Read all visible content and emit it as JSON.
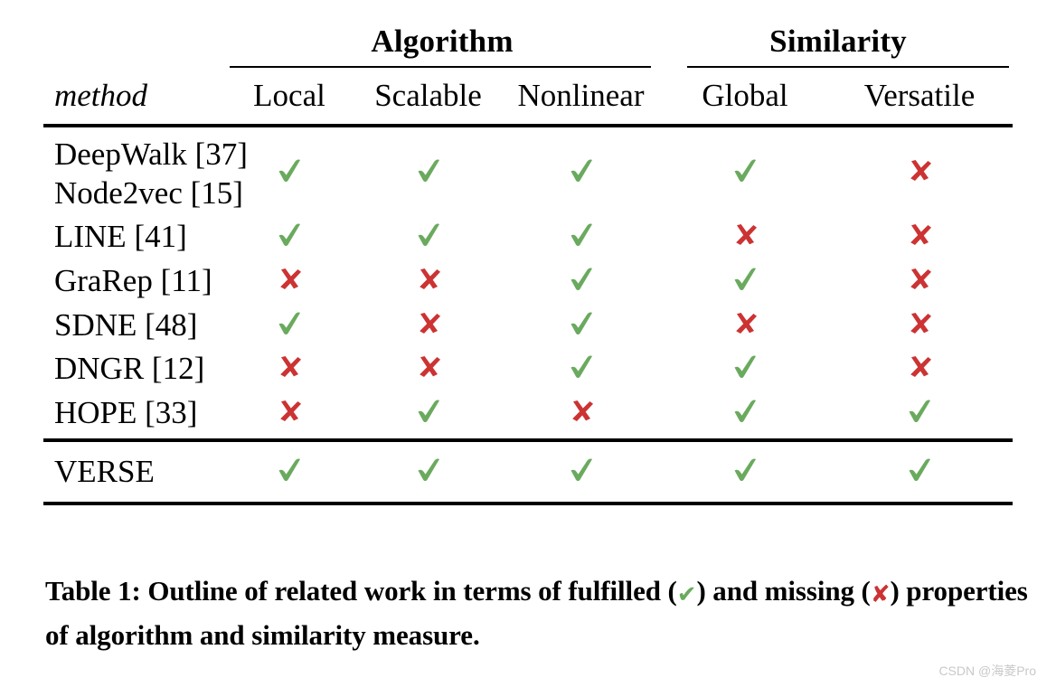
{
  "table": {
    "groups": [
      {
        "label": "Algorithm",
        "span": 3
      },
      {
        "label": "Similarity",
        "span": 2
      }
    ],
    "columns": {
      "method_header": "method",
      "marks": [
        "Local",
        "Scalable",
        "Nonlinear",
        "Global",
        "Versatile"
      ]
    },
    "rows": [
      {
        "methods": [
          "DeepWalk [37]",
          "Node2vec [15]"
        ],
        "marks": [
          "check",
          "check",
          "check",
          "check",
          "cross"
        ]
      },
      {
        "methods": [
          "LINE [41]"
        ],
        "marks": [
          "check",
          "check",
          "check",
          "cross",
          "cross"
        ]
      },
      {
        "methods": [
          "GraRep [11]"
        ],
        "marks": [
          "cross",
          "cross",
          "check",
          "check",
          "cross"
        ]
      },
      {
        "methods": [
          "SDNE [48]"
        ],
        "marks": [
          "check",
          "cross",
          "check",
          "cross",
          "cross"
        ]
      },
      {
        "methods": [
          "DNGR [12]"
        ],
        "marks": [
          "cross",
          "cross",
          "check",
          "check",
          "cross"
        ]
      },
      {
        "methods": [
          "HOPE [33]"
        ],
        "marks": [
          "cross",
          "check",
          "cross",
          "check",
          "check"
        ]
      }
    ],
    "highlight_row": {
      "methods": [
        "VERSE"
      ],
      "marks": [
        "check",
        "check",
        "check",
        "check",
        "check"
      ]
    }
  },
  "caption": {
    "line1_a": "Table 1: Outline of related work in terms of fulfilled (",
    "line1_b": ") and",
    "line2_a": "missing (",
    "line2_b": ") properties of algorithm and similarity measure."
  },
  "icons": {
    "check": "check-mark-icon",
    "cross": "cross-mark-icon"
  },
  "colors": {
    "check": "#6aaa5e",
    "cross": "#cc3333",
    "rule": "#000000",
    "watermark": "#c9c9c9"
  },
  "watermark": {
    "text": "CSDN @海菱Pro"
  }
}
